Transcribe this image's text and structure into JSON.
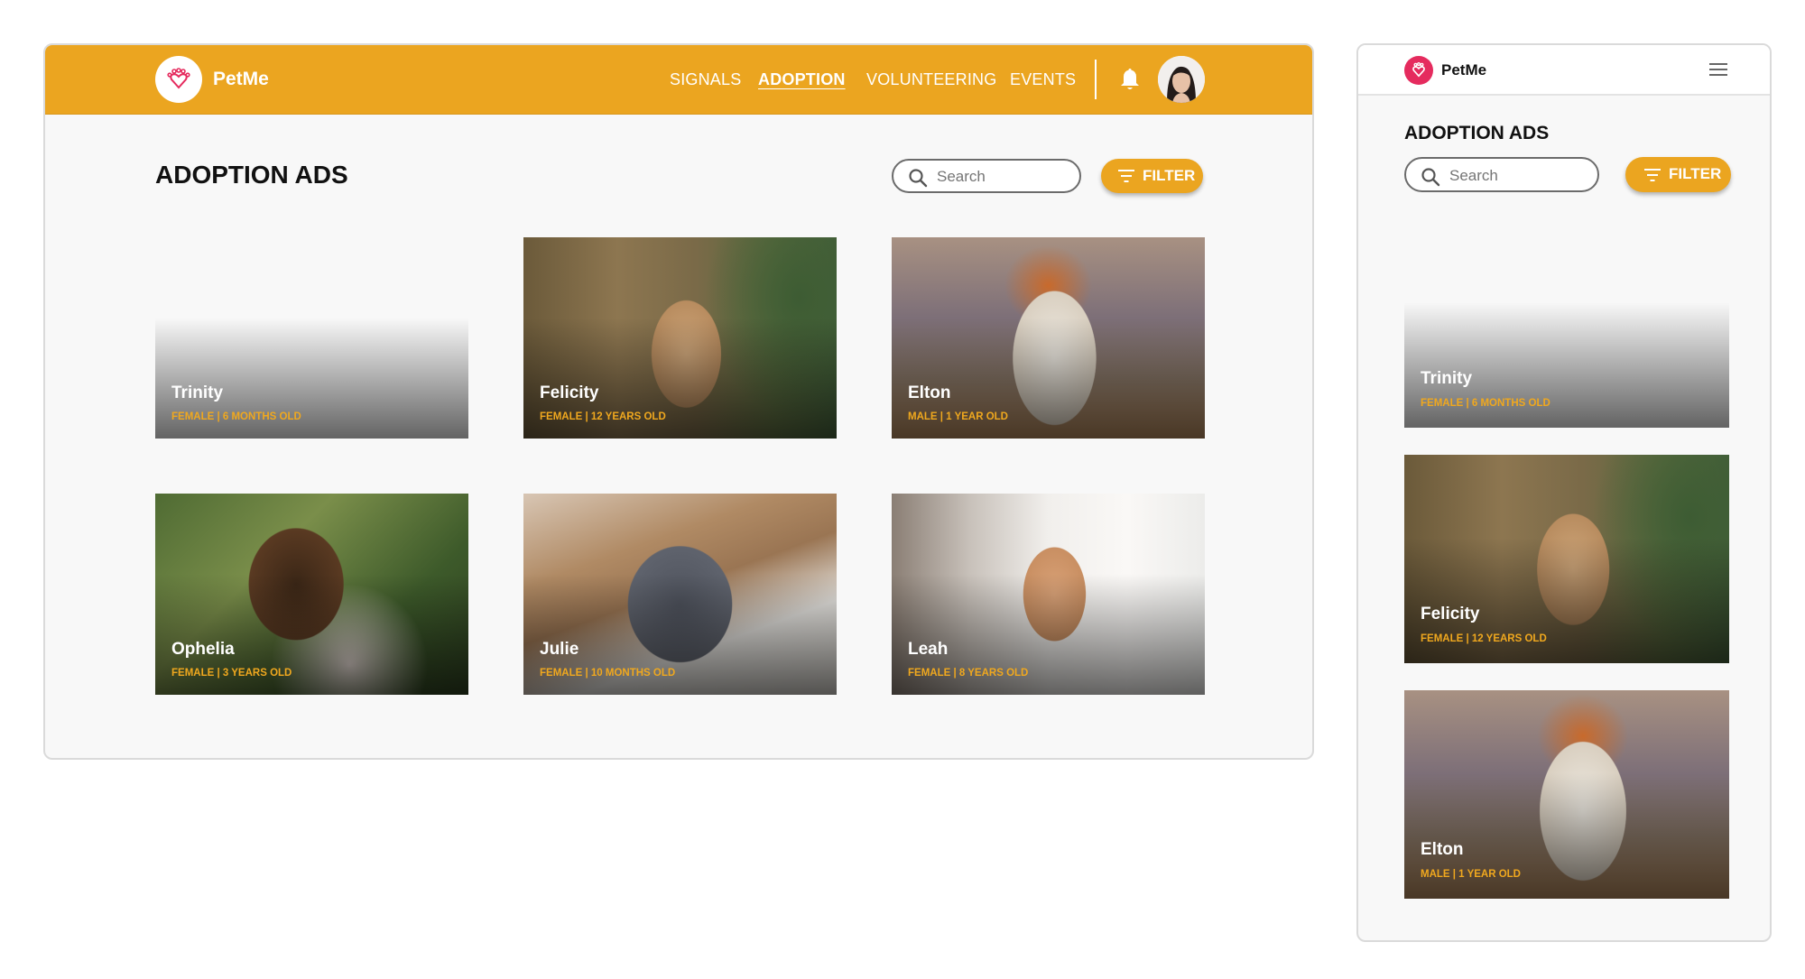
{
  "app": {
    "brand": "PetMe",
    "logo_icon": "paw-heart-icon"
  },
  "colors": {
    "brand_orange": "#eba520",
    "meta_orange": "#f0a81e",
    "logo_pink": "#e52b5e"
  },
  "nav": {
    "items": [
      {
        "label": "SIGNALS",
        "active": false
      },
      {
        "label": "ADOPTION",
        "active": true
      },
      {
        "label": "VOLUNTEERING",
        "active": false
      },
      {
        "label": "EVENTS",
        "active": false
      }
    ],
    "bell_icon": "bell-icon",
    "menu_icon": "hamburger-menu-icon"
  },
  "page": {
    "title": "ADOPTION ADS"
  },
  "search": {
    "placeholder": "Search",
    "icon": "search-icon"
  },
  "filter": {
    "label": "FILTER",
    "icon": "filter-icon"
  },
  "pets": [
    {
      "name": "Trinity",
      "meta": "FEMALE | 6 MONTHS OLD"
    },
    {
      "name": "Felicity",
      "meta": "FEMALE | 12 YEARS OLD"
    },
    {
      "name": "Elton",
      "meta": "MALE | 1 YEAR OLD"
    },
    {
      "name": "Ophelia",
      "meta": "FEMALE | 3 YEARS OLD"
    },
    {
      "name": "Julie",
      "meta": "FEMALE | 10 MONTHS OLD"
    },
    {
      "name": "Leah",
      "meta": "FEMALE | 8 YEARS OLD"
    }
  ]
}
